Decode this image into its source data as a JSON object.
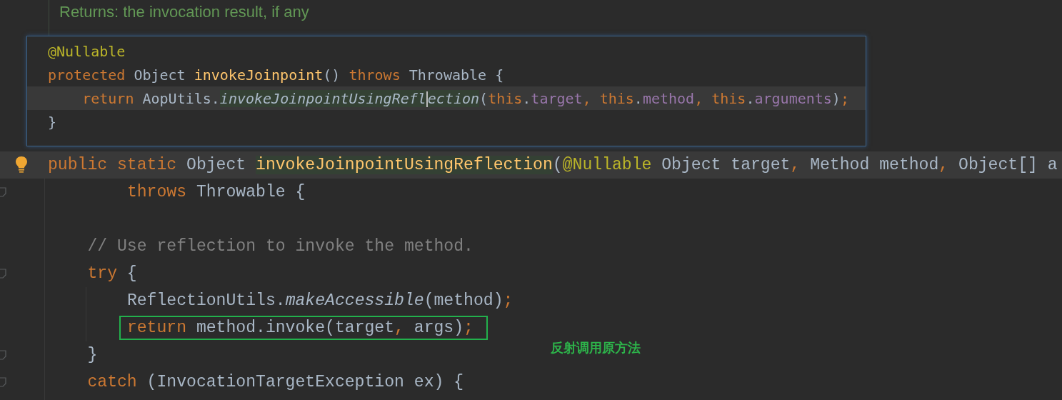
{
  "doc": {
    "returns": "Returns: the invocation result, if any"
  },
  "popup": {
    "lines": [
      {
        "current": false,
        "tokens": [
          {
            "kind": "annotation",
            "text": "@Nullable"
          }
        ]
      },
      {
        "current": false,
        "tokens": [
          {
            "kind": "keyword",
            "text": "protected"
          },
          {
            "kind": "plain",
            "text": " Object "
          },
          {
            "kind": "method-decl",
            "text": "invokeJoinpoint"
          },
          {
            "kind": "plain",
            "text": "() "
          },
          {
            "kind": "keyword",
            "text": "throws"
          },
          {
            "kind": "plain",
            "text": " Throwable {"
          }
        ],
        "children": [
          {
            "current": true,
            "tokens": [
              {
                "kind": "keyword",
                "text": "return"
              },
              {
                "kind": "plain",
                "text": " AopUtils."
              },
              {
                "kind": "usage-call",
                "text": "invokeJoinpointUsingRefl"
              },
              {
                "kind": "caret"
              },
              {
                "kind": "usage-call",
                "text": "ection"
              },
              {
                "kind": "plain",
                "text": "("
              },
              {
                "kind": "keyword",
                "text": "this"
              },
              {
                "kind": "plain",
                "text": "."
              },
              {
                "kind": "field",
                "text": "target"
              },
              {
                "kind": "punct",
                "text": ", "
              },
              {
                "kind": "keyword",
                "text": "this"
              },
              {
                "kind": "plain",
                "text": "."
              },
              {
                "kind": "field",
                "text": "method"
              },
              {
                "kind": "punct",
                "text": ", "
              },
              {
                "kind": "keyword",
                "text": "this"
              },
              {
                "kind": "plain",
                "text": "."
              },
              {
                "kind": "field",
                "text": "arguments"
              },
              {
                "kind": "plain",
                "text": ")"
              },
              {
                "kind": "punct",
                "text": ";"
              }
            ]
          }
        ]
      },
      {
        "current": false,
        "tokens": [
          {
            "kind": "plain",
            "text": "}"
          }
        ]
      }
    ]
  },
  "editor": {
    "lines": [
      {
        "kind": "line",
        "current": true,
        "boxed": false,
        "fold": false,
        "bulb": true,
        "tokens": [
          {
            "kind": "keyword",
            "text": "public "
          },
          {
            "kind": "keyword",
            "text": "static"
          },
          {
            "kind": "plain",
            "text": " Object "
          },
          {
            "kind": "usage-decl",
            "text": "invokeJoinpointUsingReflection"
          },
          {
            "kind": "plain",
            "text": "("
          },
          {
            "kind": "annotation",
            "text": "@Nullable"
          },
          {
            "kind": "plain",
            "text": " Object target"
          },
          {
            "kind": "punct",
            "text": ","
          },
          {
            "kind": "plain",
            "text": " Method method"
          },
          {
            "kind": "punct",
            "text": ","
          },
          {
            "kind": "plain",
            "text": " Object[] a"
          }
        ]
      },
      {
        "kind": "continuation",
        "current": false,
        "boxed": false,
        "fold": true,
        "bulb": false,
        "tokens": [
          {
            "kind": "keyword",
            "text": "throws"
          },
          {
            "kind": "plain",
            "text": " Throwable {"
          }
        ],
        "children": [
          {
            "kind": "line",
            "current": false,
            "fold": false,
            "bulb": false
          },
          {
            "kind": "line",
            "current": false,
            "boxed": false,
            "fold": false,
            "bulb": false,
            "tokens": [
              {
                "kind": "comment",
                "text": "// Use reflection to invoke the method."
              }
            ]
          },
          {
            "kind": "line",
            "current": false,
            "boxed": false,
            "fold": true,
            "bulb": false,
            "tokens": [
              {
                "kind": "keyword",
                "text": "try"
              },
              {
                "kind": "plain",
                "text": " {"
              }
            ],
            "children": [
              {
                "kind": "line",
                "current": false,
                "boxed": false,
                "fold": false,
                "bulb": false,
                "tokens": [
                  {
                    "kind": "plain",
                    "text": "ReflectionUtils."
                  },
                  {
                    "kind": "italic",
                    "text": "makeAccessible"
                  },
                  {
                    "kind": "plain",
                    "text": "(method)"
                  },
                  {
                    "kind": "punct",
                    "text": ";"
                  }
                ]
              },
              {
                "kind": "line",
                "current": false,
                "boxed": true,
                "fold": false,
                "bulb": false,
                "tokens": [
                  {
                    "kind": "keyword",
                    "text": "return"
                  },
                  {
                    "kind": "plain",
                    "text": " method.invoke(target"
                  },
                  {
                    "kind": "punct",
                    "text": ","
                  },
                  {
                    "kind": "plain",
                    "text": " args)"
                  },
                  {
                    "kind": "punct",
                    "text": ";"
                  }
                ]
              }
            ]
          },
          {
            "kind": "line",
            "current": false,
            "boxed": false,
            "fold": true,
            "bulb": false,
            "tokens": [
              {
                "kind": "plain",
                "text": "}"
              }
            ]
          },
          {
            "kind": "line",
            "current": false,
            "boxed": false,
            "fold": true,
            "bulb": false,
            "tokens": [
              {
                "kind": "keyword",
                "text": "catch"
              },
              {
                "kind": "plain",
                "text": " (InvocationTargetException ex) {"
              }
            ]
          }
        ]
      }
    ]
  },
  "note": "反射调用原方法"
}
